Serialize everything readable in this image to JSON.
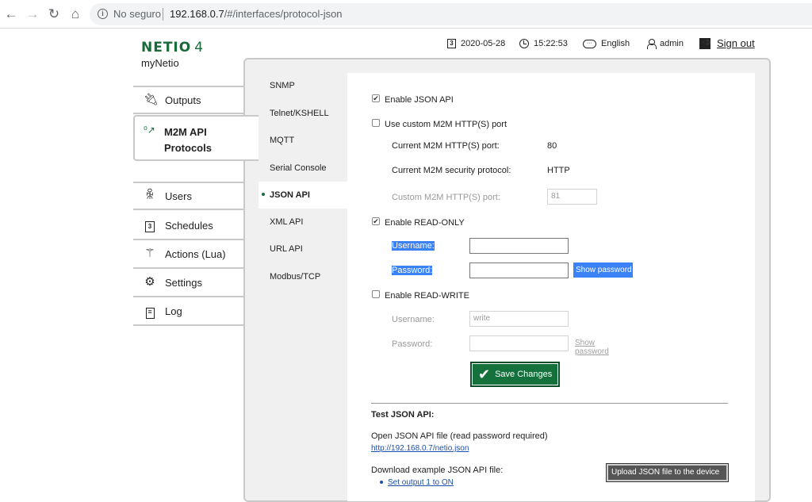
{
  "browser": {
    "not_secure": "No seguro",
    "url_host": "192.168.0.7",
    "url_path": "/#/interfaces/protocol-json"
  },
  "header": {
    "logo": "NETIO",
    "logo_suffix": "4",
    "device_name": "myNetio",
    "date": "2020-05-28",
    "time": "15:22:53",
    "language": "English",
    "user": "admin",
    "sign_out": "Sign out"
  },
  "menu": {
    "outputs": "Outputs",
    "m2m_line1": "M2M API",
    "m2m_line2": "Protocols",
    "users": "Users",
    "schedules": "Schedules",
    "actions": "Actions (Lua)",
    "settings": "Settings",
    "log": "Log"
  },
  "subnav": {
    "snmp": "SNMP",
    "telnet": "Telnet/KSHELL",
    "mqtt": "MQTT",
    "serial": "Serial Console",
    "json": "JSON API",
    "xml": "XML API",
    "url": "URL API",
    "modbus": "Modbus/TCP"
  },
  "form": {
    "enable_json": "Enable JSON API",
    "enable_json_checked": true,
    "custom_port": "Use custom M2M HTTP(S) port",
    "custom_port_checked": false,
    "current_port_label": "Current M2M HTTP(S) port:",
    "current_port_value": "80",
    "security_label": "Current M2M security protocol:",
    "security_value": "HTTP",
    "custom_port_label": "Custom M2M HTTP(S) port:",
    "custom_port_value": "81",
    "enable_ro": "Enable READ-ONLY",
    "enable_ro_checked": true,
    "ro_username_label": "Username:",
    "ro_username_value": "",
    "ro_password_label": "Password:",
    "ro_password_value": "",
    "ro_show_password": "Show password",
    "enable_rw": "Enable READ-WRITE",
    "enable_rw_checked": false,
    "rw_username_label": "Username:",
    "rw_username_value": "write",
    "rw_password_label": "Password:",
    "rw_password_value": "",
    "rw_show_password": "Show password",
    "save": "Save Changes"
  },
  "test": {
    "title": "Test JSON API:",
    "open_text": "Open JSON API file (read password required)",
    "open_link": "http://192.168.0.7/netio.json",
    "download_text": "Download example JSON API file:",
    "example_1": "Set output 1 to ON",
    "upload_button": "Upload JSON file to the device"
  },
  "colors": {
    "brand_green": "#15713c",
    "selection_blue": "#3b82f6",
    "link_blue": "#1c4fa8"
  }
}
